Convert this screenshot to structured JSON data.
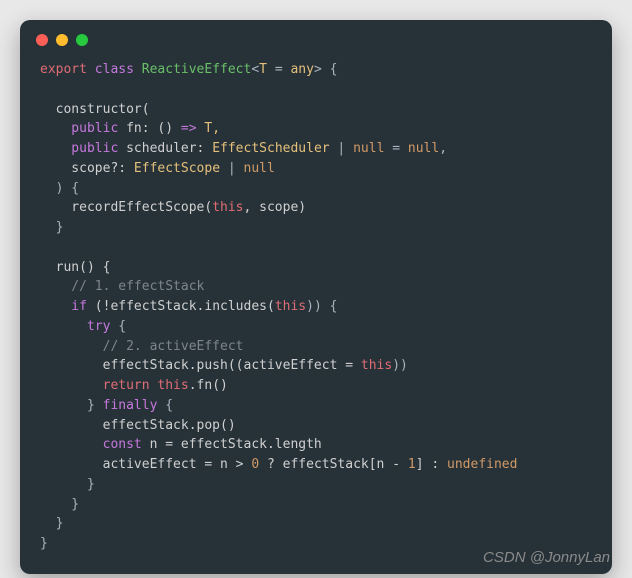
{
  "code": {
    "l1_export": "export",
    "l1_class": "class",
    "l1_name": "ReactiveEffect",
    "l1_generic_open": "<",
    "l1_T": "T",
    "l1_eq": " = ",
    "l1_any": "any",
    "l1_generic_close": "> {",
    "l3_constructor": "  constructor(",
    "l4_public": "    public",
    "l4_fn": " fn: () ",
    "l4_arrow": "=>",
    "l4_T": " T,",
    "l5_public": "    public",
    "l5_sched": " scheduler: ",
    "l5_type": "EffectScheduler",
    "l5_pipe": " | ",
    "l5_null": "null",
    "l5_eq": " = ",
    "l5_null2": "null",
    "l5_comma": ",",
    "l6_scope": "    scope?: ",
    "l6_type": "EffectScope",
    "l6_pipe": " | ",
    "l6_null": "null",
    "l7_close": "  ) {",
    "l8_record": "    recordEffectScope(",
    "l8_this": "this",
    "l8_rest": ", scope)",
    "l9_close": "  }",
    "l11_run": "  run() {",
    "l12_comment": "    // 1. effectStack",
    "l13_if": "    if",
    "l13_cond": " (!effectStack.includes(",
    "l13_this": "this",
    "l13_close": ")) {",
    "l14_try": "      try",
    "l14_brace": " {",
    "l15_comment": "        // 2. activeEffect",
    "l16_push": "        effectStack.push((activeEffect = ",
    "l16_this": "this",
    "l16_close": "))",
    "l17_return": "        return",
    "l17_this": " this",
    "l17_fn": ".fn()",
    "l18_close": "      }",
    "l18_finally": " finally",
    "l18_brace": " {",
    "l19_pop": "        effectStack.pop()",
    "l20_const": "        const",
    "l20_n": " n = effectStack.length",
    "l21_active": "        activeEffect = n > ",
    "l21_zero": "0",
    "l21_tern": " ? effectStack[n - ",
    "l21_one": "1",
    "l21_close": "] : ",
    "l21_undef": "undefined",
    "l22_close": "      }",
    "l23_close": "    }",
    "l24_close": "  }",
    "l25_close": "}"
  },
  "watermark": "CSDN @JonnyLan"
}
